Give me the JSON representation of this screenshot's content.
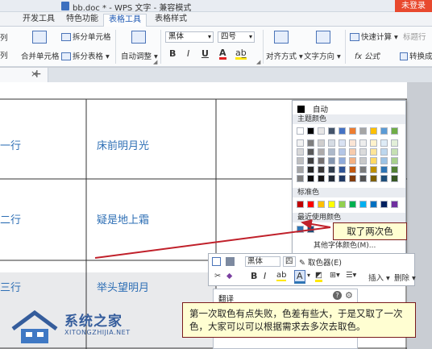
{
  "window": {
    "title": "bb.doc * - WPS 文字 - 兼容模式",
    "login_label": "未登录"
  },
  "ribbon_tabs": [
    "开发工具",
    "特色功能",
    "表格工具",
    "表格样式"
  ],
  "ribbon": {
    "col0_a": "列",
    "col0_b": "列",
    "merge_cells": "合并单元格",
    "split_cells": "拆分单元格",
    "split_table": "拆分表格",
    "auto_fit": "自动调整",
    "font_name": "黑体",
    "font_size": "四号",
    "bold": "B",
    "italic": "I",
    "underline": "U",
    "font_color": "A",
    "align": "对齐方式",
    "text_direction": "文字方向",
    "quick_calc": "快速计算",
    "title_row": "标题行",
    "formula": "fx 公式",
    "convert_text": "转换成"
  },
  "doc_tab": {
    "close": "×",
    "new": "+"
  },
  "table": {
    "rows": [
      [
        "一行",
        "床前明月光"
      ],
      [
        "二行",
        "疑是地上霜"
      ],
      [
        "三行",
        "举头望明月"
      ]
    ]
  },
  "color_popup": {
    "auto_label": "自动",
    "theme_label": "主题颜色",
    "standard_label": "标准色",
    "recent_label": "最近使用颜色",
    "more_label": "其他字体颜色(M)...",
    "picker_label": "取色器(E)",
    "theme_top": [
      "#ffffff",
      "#000000",
      "#e7e6e6",
      "#44546a",
      "#4472c4",
      "#ed7d31",
      "#a5a5a5",
      "#ffc000",
      "#5b9bd5",
      "#70ad47"
    ],
    "theme_tints": [
      [
        "#f2f2f2",
        "#7f7f7f",
        "#d0cece",
        "#d6dce4",
        "#d9e2f3",
        "#fbe5d5",
        "#ededed",
        "#fff2cc",
        "#deebf6",
        "#e2efd9"
      ],
      [
        "#d8d8d8",
        "#595959",
        "#aeabab",
        "#adb9ca",
        "#b4c6e7",
        "#f7cbac",
        "#dbdbdb",
        "#fee599",
        "#bdd7ee",
        "#c5e0b3"
      ],
      [
        "#bfbfbf",
        "#3f3f3f",
        "#757070",
        "#8496b0",
        "#8eaadb",
        "#f4b183",
        "#c9c9c9",
        "#ffd965",
        "#9cc3e5",
        "#a8d08d"
      ],
      [
        "#a5a5a5",
        "#262626",
        "#3a3838",
        "#323f4f",
        "#2f5496",
        "#c55a11",
        "#7b7b7b",
        "#bf9000",
        "#2e75b5",
        "#538135"
      ],
      [
        "#7f7f7f",
        "#0c0c0c",
        "#171616",
        "#222a35",
        "#1f3864",
        "#833c0b",
        "#525252",
        "#7f6000",
        "#1e4e79",
        "#375623"
      ]
    ],
    "standard": [
      "#c00000",
      "#ff0000",
      "#ffc000",
      "#ffff00",
      "#92d050",
      "#00b050",
      "#00b0f0",
      "#0070c0",
      "#002060",
      "#7030a0"
    ],
    "recent": [
      "#2e75b5",
      "#1f4e79"
    ]
  },
  "float_toolbar": {
    "font_name": "黑体",
    "font_size": "四",
    "bold": "B",
    "italic": "I",
    "font_color": "A",
    "insert": "插入",
    "delete": "删除"
  },
  "translate": {
    "title": "翻译"
  },
  "callouts": {
    "twice": "取了两次色",
    "note": "第一次取色有点失败，色差有些大，于是又取了一次色，大家可以可以根据需求去多次去取色。"
  },
  "watermark": {
    "name": "系统之家",
    "url": "XITONGZHIJIA.NET"
  },
  "colors": {
    "accent": "#1a56b3",
    "callout_border": "#7a1c1c",
    "callout_bg": "#fffed2",
    "arrow": "#c0202a",
    "login": "#e8492e"
  }
}
